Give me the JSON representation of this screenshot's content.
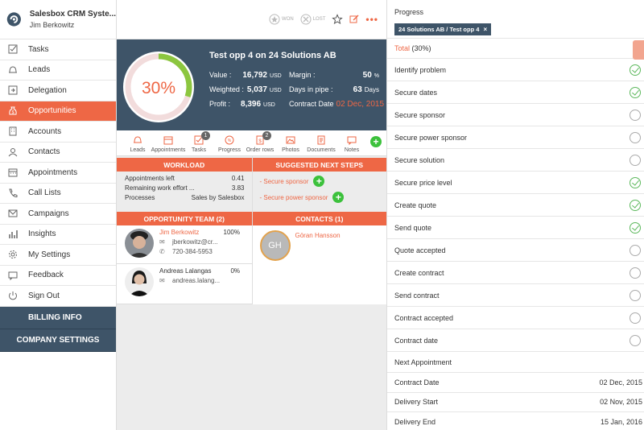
{
  "brand": {
    "title": "Salesbox CRM Syste...",
    "user": "Jim Berkowitz"
  },
  "sidebar": {
    "items": [
      {
        "label": "Tasks",
        "icon": "checkbox-icon"
      },
      {
        "label": "Leads",
        "icon": "bell-icon"
      },
      {
        "label": "Delegation",
        "icon": "arrow-box-icon"
      },
      {
        "label": "Opportunities",
        "icon": "money-bag-icon",
        "active": true
      },
      {
        "label": "Accounts",
        "icon": "building-icon"
      },
      {
        "label": "Contacts",
        "icon": "person-icon"
      },
      {
        "label": "Appointments",
        "icon": "calendar-icon"
      },
      {
        "label": "Call Lists",
        "icon": "phone-icon"
      },
      {
        "label": "Campaigns",
        "icon": "envelope-icon"
      },
      {
        "label": "Insights",
        "icon": "bar-chart-icon"
      },
      {
        "label": "My Settings",
        "icon": "gear-icon"
      },
      {
        "label": "Feedback",
        "icon": "speech-icon"
      },
      {
        "label": "Sign Out",
        "icon": "power-icon"
      }
    ],
    "billing": "BILLING INFO",
    "company": "COMPANY SETTINGS"
  },
  "topbar": {
    "won": "WON",
    "lost": "LOST"
  },
  "opportunity": {
    "title": "Test opp 4 on 24 Solutions AB",
    "percent": "30%",
    "progress": 0.3,
    "value_label": "Value :",
    "value": "16,792",
    "value_unit": "USD",
    "weighted_label": "Weighted :",
    "weighted": "5,037",
    "weighted_unit": "USD",
    "profit_label": "Profit :",
    "profit": "8,396",
    "profit_unit": "USD",
    "margin_label": "Margin :",
    "margin": "50",
    "margin_unit": "%",
    "days_label": "Days in pipe :",
    "days": "63",
    "days_unit": "Days",
    "contract_label": "Contract Date",
    "contract_date": "02 Dec, 2015"
  },
  "tabs": [
    {
      "label": "Leads"
    },
    {
      "label": "Appointments"
    },
    {
      "label": "Tasks",
      "badge": "1"
    },
    {
      "label": "Progress"
    },
    {
      "label": "Order rows",
      "badge": "2"
    },
    {
      "label": "Photos"
    },
    {
      "label": "Documents"
    },
    {
      "label": "Notes"
    }
  ],
  "workload": {
    "header": "WORKLOAD",
    "rows": [
      {
        "label": "Appointments left",
        "value": "0.41"
      },
      {
        "label": "Remaining work effort ...",
        "value": "3.83"
      },
      {
        "label": "Processes",
        "value": "Sales by Salesbox"
      }
    ]
  },
  "next_steps": {
    "header": "SUGGESTED NEXT STEPS",
    "items": [
      "- Secure sponsor",
      "- Secure power sponsor"
    ]
  },
  "team": {
    "header": "OPPORTUNITY TEAM (2)",
    "members": [
      {
        "name": "Jim Berkowitz",
        "pct": "100%",
        "email": "jberkowitz@cr...",
        "phone": "720-384-5953"
      },
      {
        "name": "Andreas Lalangas",
        "pct": "0%",
        "email": "andreas.lalang..."
      }
    ]
  },
  "contacts": {
    "header": "CONTACTS (1)",
    "items": [
      {
        "initials": "GH",
        "name": "Göran Hansson"
      }
    ]
  },
  "progress_panel": {
    "title": "Progress",
    "chip": "24 Solutions AB / Test opp 4",
    "total_label": "Total",
    "total_value": "(30%)",
    "steps": [
      {
        "label": "Identify problem",
        "done": true
      },
      {
        "label": "Secure dates",
        "done": true
      },
      {
        "label": "Secure sponsor",
        "done": false
      },
      {
        "label": "Secure power sponsor",
        "done": false
      },
      {
        "label": "Secure solution",
        "done": false
      },
      {
        "label": "Secure price level",
        "done": true
      },
      {
        "label": "Create quote",
        "done": true
      },
      {
        "label": "Send quote",
        "done": true
      },
      {
        "label": "Quote accepted",
        "done": false
      },
      {
        "label": "Create contract",
        "done": false
      },
      {
        "label": "Send contract",
        "done": false
      },
      {
        "label": "Contract accepted",
        "done": false
      },
      {
        "label": "Contract date",
        "done": false
      }
    ],
    "next_appointment": "Next Appointment",
    "dates": [
      {
        "label": "Contract Date",
        "value": "02 Dec, 2015"
      },
      {
        "label": "Delivery Start",
        "value": "02 Nov, 2015"
      },
      {
        "label": "Delivery End",
        "value": "15 Jan, 2016"
      }
    ]
  },
  "colors": {
    "accent": "#ee6745",
    "navy": "#3e5468",
    "green": "#3cc13c",
    "ring": "#8cc63f"
  }
}
